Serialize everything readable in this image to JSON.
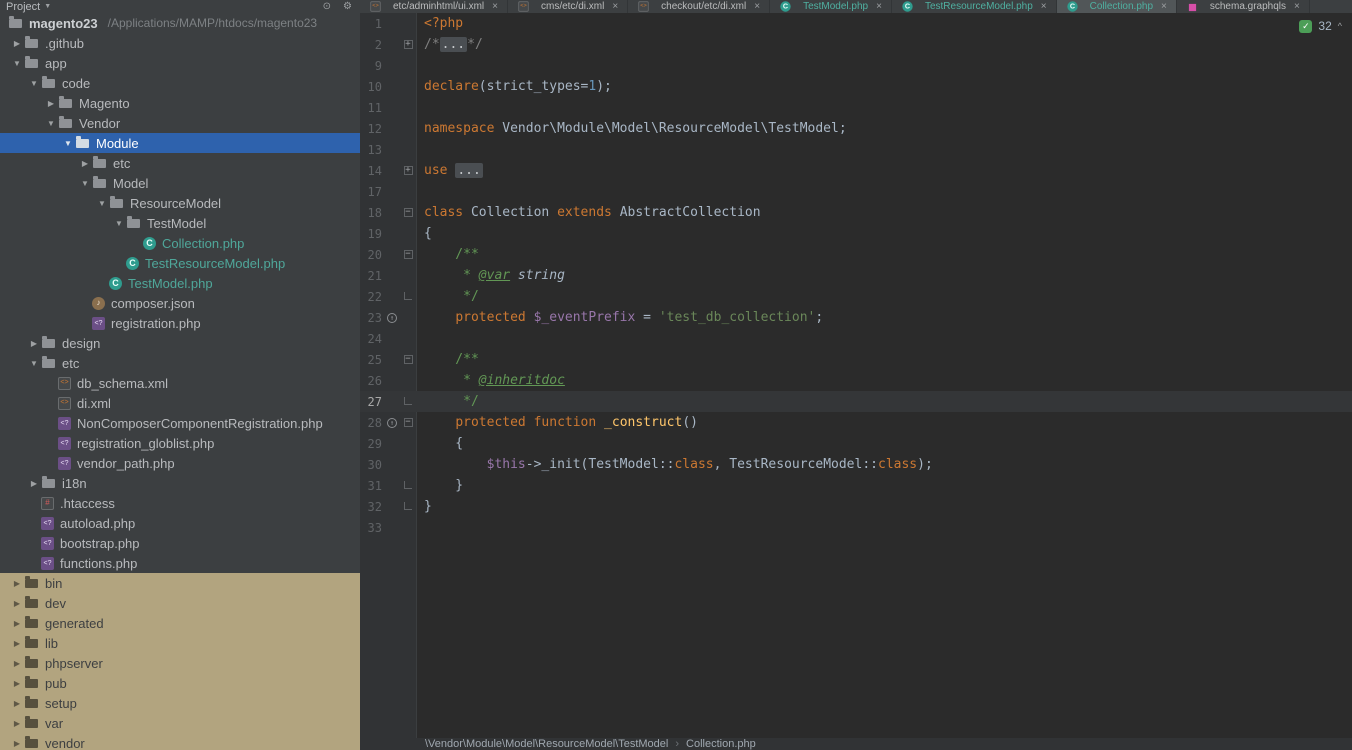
{
  "project_panel": {
    "title": "Project",
    "caret": "▼",
    "icons": [
      {
        "name": "locate-icon",
        "glyph": "⊙"
      },
      {
        "name": "settings-gear-icon",
        "glyph": "⚙"
      }
    ]
  },
  "tabs": {
    "close_glyph": "×",
    "items": [
      {
        "label": "etc/adminhtml/ui.xml",
        "icon": "xml"
      },
      {
        "label": "cms/etc/di.xml",
        "icon": "xml"
      },
      {
        "label": "checkout/etc/di.xml",
        "icon": "xml"
      },
      {
        "label": "TestModel.php",
        "icon": "class",
        "teal": true
      },
      {
        "label": "TestResourceModel.php",
        "icon": "class",
        "teal": true
      },
      {
        "label": "Collection.php",
        "icon": "class",
        "teal": true,
        "active": true
      },
      {
        "label": "schema.graphqls",
        "icon": "graphql"
      }
    ]
  },
  "tree": {
    "items": [
      {
        "label": "magento23",
        "lvl": 0,
        "icon": "folder",
        "bold": true,
        "note": "/Applications/MAMP/htdocs/magento23"
      },
      {
        "label": ".github",
        "lvl": 1,
        "chev": "r",
        "icon": "folder"
      },
      {
        "label": "app",
        "lvl": 1,
        "chev": "d",
        "icon": "folder"
      },
      {
        "label": "code",
        "lvl": 2,
        "chev": "d",
        "icon": "folder"
      },
      {
        "label": "Magento",
        "lvl": 3,
        "chev": "r",
        "icon": "folder"
      },
      {
        "label": "Vendor",
        "lvl": 3,
        "chev": "d",
        "icon": "folder"
      },
      {
        "label": "Module",
        "lvl": 4,
        "chev": "d",
        "icon": "folder",
        "selected": true
      },
      {
        "label": "etc",
        "lvl": 5,
        "chev": "r",
        "icon": "folder"
      },
      {
        "label": "Model",
        "lvl": 5,
        "chev": "d",
        "icon": "folder"
      },
      {
        "label": "ResourceModel",
        "lvl": 6,
        "chev": "d",
        "icon": "folder"
      },
      {
        "label": "TestModel",
        "lvl": 7,
        "chev": "d",
        "icon": "folder"
      },
      {
        "label": "Collection.php",
        "lvl": 8,
        "icon": "class",
        "teal": true
      },
      {
        "label": "TestResourceModel.php",
        "lvl": 7,
        "icon": "class",
        "teal": true
      },
      {
        "label": "TestModel.php",
        "lvl": 6,
        "icon": "class",
        "teal": true
      },
      {
        "label": "composer.json",
        "lvl": 5,
        "icon": "composer"
      },
      {
        "label": "registration.php",
        "lvl": 5,
        "icon": "php"
      },
      {
        "label": "design",
        "lvl": 2,
        "chev": "r",
        "icon": "folder"
      },
      {
        "label": "etc",
        "lvl": 2,
        "chev": "d",
        "icon": "folder"
      },
      {
        "label": "db_schema.xml",
        "lvl": 3,
        "icon": "xml"
      },
      {
        "label": "di.xml",
        "lvl": 3,
        "icon": "xml"
      },
      {
        "label": "NonComposerComponentRegistration.php",
        "lvl": 3,
        "icon": "php"
      },
      {
        "label": "registration_globlist.php",
        "lvl": 3,
        "icon": "php"
      },
      {
        "label": "vendor_path.php",
        "lvl": 3,
        "icon": "php"
      },
      {
        "label": "i18n",
        "lvl": 2,
        "chev": "r",
        "icon": "folder"
      },
      {
        "label": ".htaccess",
        "lvl": 2,
        "icon": "htaccess"
      },
      {
        "label": "autoload.php",
        "lvl": 2,
        "icon": "php"
      },
      {
        "label": "bootstrap.php",
        "lvl": 2,
        "icon": "php"
      },
      {
        "label": "functions.php",
        "lvl": 2,
        "icon": "php"
      },
      {
        "label": "bin",
        "lvl": 1,
        "chev": "r",
        "icon": "folder",
        "tan": true
      },
      {
        "label": "dev",
        "lvl": 1,
        "chev": "r",
        "icon": "folder",
        "tan": true
      },
      {
        "label": "generated",
        "lvl": 1,
        "chev": "r",
        "icon": "folder",
        "tan": true
      },
      {
        "label": "lib",
        "lvl": 1,
        "chev": "r",
        "icon": "folder",
        "tan": true
      },
      {
        "label": "phpserver",
        "lvl": 1,
        "chev": "r",
        "icon": "folder",
        "tan": true
      },
      {
        "label": "pub",
        "lvl": 1,
        "chev": "r",
        "icon": "folder",
        "tan": true
      },
      {
        "label": "setup",
        "lvl": 1,
        "chev": "r",
        "icon": "folder",
        "tan": true
      },
      {
        "label": "var",
        "lvl": 1,
        "chev": "r",
        "icon": "folder",
        "tan": true
      },
      {
        "label": "vendor",
        "lvl": 1,
        "chev": "r",
        "icon": "folder",
        "tan": true
      }
    ]
  },
  "editor": {
    "lines": [
      {
        "n": 1,
        "t": [
          [
            "kw",
            "<?php"
          ]
        ]
      },
      {
        "n": 2,
        "f": "p",
        "t": [
          [
            "com",
            "/*"
          ],
          [
            "fold",
            "..."
          ],
          [
            "com",
            "*/"
          ]
        ]
      },
      {
        "n": 9,
        "t": []
      },
      {
        "n": 10,
        "t": [
          [
            "kw",
            "declare"
          ],
          [
            "txt",
            "(strict_types="
          ],
          [
            "num",
            "1"
          ],
          [
            "txt",
            ");"
          ]
        ]
      },
      {
        "n": 11,
        "t": []
      },
      {
        "n": 12,
        "t": [
          [
            "kw",
            "namespace "
          ],
          [
            "txt",
            "Vendor\\Module\\Model\\ResourceModel\\TestModel;"
          ]
        ]
      },
      {
        "n": 13,
        "t": []
      },
      {
        "n": 14,
        "f": "p",
        "t": [
          [
            "kw",
            "use "
          ],
          [
            "fold",
            "..."
          ]
        ]
      },
      {
        "n": 17,
        "t": []
      },
      {
        "n": 18,
        "f": "m",
        "t": [
          [
            "kw",
            "class "
          ],
          [
            "txt",
            "Collection "
          ],
          [
            "kw",
            "extends "
          ],
          [
            "txt",
            "AbstractCollection"
          ]
        ]
      },
      {
        "n": 19,
        "t": [
          [
            "txt",
            "{"
          ]
        ]
      },
      {
        "n": 20,
        "f": "m",
        "t": [
          [
            "doc",
            "    /**"
          ]
        ]
      },
      {
        "n": 21,
        "t": [
          [
            "doc",
            "     * "
          ],
          [
            "tag",
            "@var"
          ],
          [
            "typ",
            " string"
          ]
        ]
      },
      {
        "n": 22,
        "f": "e",
        "t": [
          [
            "doc",
            "     */"
          ]
        ]
      },
      {
        "n": 23,
        "g": "o",
        "t": [
          [
            "txt",
            "    "
          ],
          [
            "kw",
            "protected "
          ],
          [
            "var",
            "$_eventPrefix"
          ],
          [
            "txt",
            " = "
          ],
          [
            "str",
            "'test_db_collection'"
          ],
          [
            "txt",
            ";"
          ]
        ]
      },
      {
        "n": 24,
        "t": []
      },
      {
        "n": 25,
        "f": "m",
        "t": [
          [
            "doc",
            "    /**"
          ]
        ]
      },
      {
        "n": 26,
        "t": [
          [
            "doc",
            "     * "
          ],
          [
            "tag",
            "@inheritdoc"
          ]
        ]
      },
      {
        "n": 27,
        "f": "e",
        "cur": true,
        "t": [
          [
            "doc",
            "     */"
          ]
        ]
      },
      {
        "n": 28,
        "g": "o",
        "f": "m",
        "t": [
          [
            "txt",
            "    "
          ],
          [
            "kw",
            "protected "
          ],
          [
            "kw",
            "function "
          ],
          [
            "fn",
            "_construct"
          ],
          [
            "txt",
            "()"
          ]
        ]
      },
      {
        "n": 29,
        "t": [
          [
            "txt",
            "    {"
          ]
        ]
      },
      {
        "n": 30,
        "t": [
          [
            "txt",
            "        "
          ],
          [
            "var",
            "$this"
          ],
          [
            "txt",
            "->_init(TestModel::"
          ],
          [
            "kw",
            "class"
          ],
          [
            "txt",
            ", TestResourceModel::"
          ],
          [
            "kw",
            "class"
          ],
          [
            "txt",
            ");"
          ]
        ]
      },
      {
        "n": 31,
        "f": "e",
        "t": [
          [
            "txt",
            "    }"
          ]
        ]
      },
      {
        "n": 32,
        "f": "e",
        "t": [
          [
            "txt",
            "}"
          ]
        ]
      },
      {
        "n": 33,
        "t": []
      }
    ]
  },
  "inspections": {
    "count": "32",
    "check_glyph": "✓",
    "collapse_glyph": "^"
  },
  "breadcrumbs": {
    "separator": "›",
    "items": [
      "\\Vendor\\Module\\Model\\ResourceModel\\TestModel",
      "Collection.php"
    ]
  },
  "colors": {
    "panel_bg": "#3c3f41",
    "editor_bg": "#2b2b2b",
    "selection_blue": "#2e62ad",
    "excluded_tan": "#b2a47f",
    "keyword_orange": "#cc7832",
    "string_green": "#6a8759",
    "teal_file": "#4fa79a"
  }
}
